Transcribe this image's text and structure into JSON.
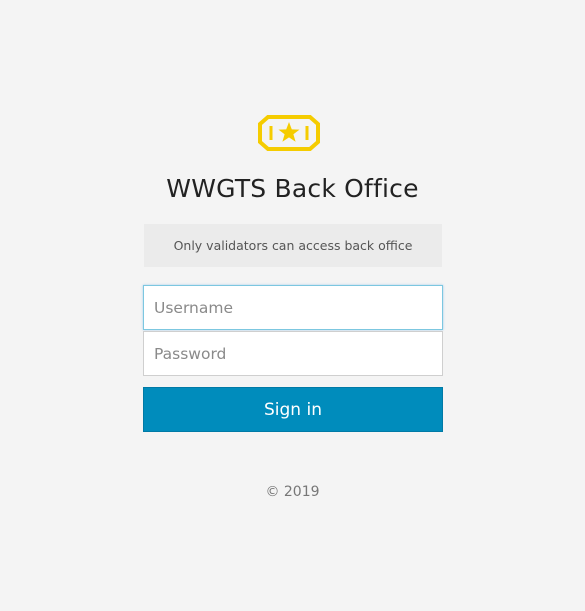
{
  "brand": {
    "title": "WWGTS Back Office",
    "logo_icon": "ticket-star-icon",
    "logo_color": "#f5cc00"
  },
  "notice": {
    "text": "Only validators can access back office"
  },
  "form": {
    "username_placeholder": "Username",
    "password_placeholder": "Password",
    "signin_label": "Sign in",
    "signin_color": "#008cbc"
  },
  "footer": {
    "copyright": "© 2019"
  }
}
